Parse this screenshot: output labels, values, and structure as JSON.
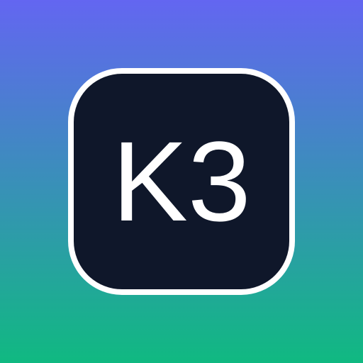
{
  "icon": {
    "label": "K3",
    "background_gradient": [
      "#6366f1",
      "#10b981"
    ],
    "tile_color": "#0f172a",
    "tile_border_color": "#ffffff",
    "label_color": "#ffffff"
  }
}
